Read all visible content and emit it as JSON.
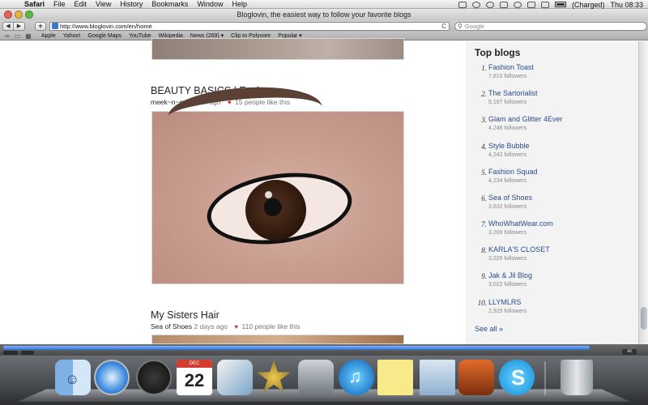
{
  "menubar": {
    "items": [
      "Safari",
      "File",
      "Edit",
      "View",
      "History",
      "Bookmarks",
      "Window",
      "Help"
    ],
    "battery": "(Charged)",
    "clock": "Thu 08:33"
  },
  "window": {
    "title": "Bloglovin, the easiest way to follow your favorite blogs"
  },
  "toolbar": {
    "url": "http://www.bloglovin.com/en/home",
    "search_placeholder": "Google"
  },
  "bookmarks": [
    "Apple",
    "Yahoo!",
    "Google Maps",
    "YouTube",
    "Wikipedia",
    "News (269) ▾",
    "Clip to Polyvore",
    "Popular ▾"
  ],
  "feed": {
    "posts": [
      {
        "title": "BEAUTY BASICS | Eyebrows",
        "author": "meek~n~mild",
        "time": "19 h ago",
        "likes": "15 people like this"
      },
      {
        "title": "My Sisters Hair",
        "author": "Sea of Shoes",
        "time": "2 days ago",
        "likes": "110 people like this"
      }
    ]
  },
  "sidebar": {
    "title": "Top blogs",
    "blogs": [
      {
        "rank": "1.",
        "name": "Fashion Toast",
        "followers": "7,810 followers"
      },
      {
        "rank": "2.",
        "name": "The Sartorialist",
        "followers": "5,197 followers"
      },
      {
        "rank": "3.",
        "name": "Glam and Glitter 4Ever",
        "followers": "4,248 followers"
      },
      {
        "rank": "4.",
        "name": "Style Bubble",
        "followers": "4,242 followers"
      },
      {
        "rank": "5.",
        "name": "Fashion Squad",
        "followers": "4,234 followers"
      },
      {
        "rank": "6.",
        "name": "Sea of Shoes",
        "followers": "3,632 followers"
      },
      {
        "rank": "7.",
        "name": "WhoWhatWear.com",
        "followers": "3,209 followers"
      },
      {
        "rank": "8.",
        "name": "KARLA'S CLOSET",
        "followers": "3,026 followers"
      },
      {
        "rank": "9.",
        "name": "Jak & Jil Blog",
        "followers": "3,022 followers"
      },
      {
        "rank": "10.",
        "name": "LLYMLRS",
        "followers": "2,929 followers"
      }
    ],
    "see_all": "See all »"
  },
  "statusbar": {
    "all_label": "All"
  },
  "dock": {
    "ical_month": "DEC",
    "ical_day": "22"
  },
  "colors": {
    "link": "#2a4c8d",
    "heart": "#d23030",
    "sidebar_bg": "#f3f3f3"
  }
}
